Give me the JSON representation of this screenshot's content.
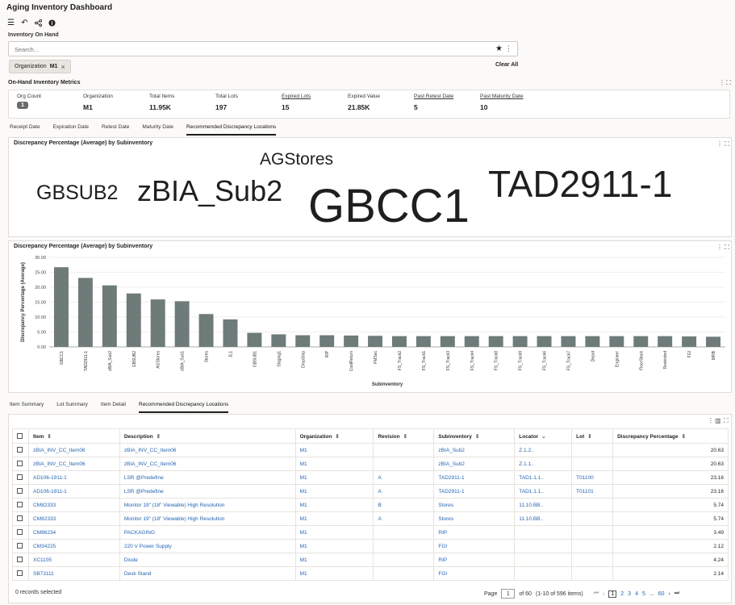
{
  "app": {
    "title": "Aging Inventory Dashboard"
  },
  "toolbar": {
    "icons": [
      "menu-icon",
      "undo-icon",
      "share-icon",
      "info-icon"
    ]
  },
  "section": {
    "inventory_on_hand": "Inventory On Hand"
  },
  "search": {
    "placeholder": "Search...",
    "value": ""
  },
  "filter_chip": {
    "label": "Organization",
    "value": "M1",
    "close": "×"
  },
  "clear_all": "Clear All",
  "metrics": {
    "title": "On-Hand Inventory Metrics",
    "items": [
      {
        "label": "Org Count",
        "value": "1"
      },
      {
        "label": "Organization",
        "value": "M1"
      },
      {
        "label": "Total Items",
        "value": "11.95K"
      },
      {
        "label": "Total Lots",
        "value": "197"
      },
      {
        "label": "Expired Lots",
        "value": "15"
      },
      {
        "label": "Expired Value",
        "value": "21.85K"
      },
      {
        "label": "Past Retest Date",
        "value": "5"
      },
      {
        "label": "Past Maturity Date",
        "value": "10"
      }
    ]
  },
  "tabs_top": [
    "Receipt Date",
    "Expiration Date",
    "Retest Date",
    "Maturity Date",
    "Recommended Discrepancy Locations"
  ],
  "tag_cloud": {
    "title": "Discrepancy Percentage (Average) by Subinventory",
    "words": [
      "GBSUB2",
      "zBIA_Sub2",
      "AGStores",
      "GBCC1",
      "TAD2911-1"
    ]
  },
  "chart_data": {
    "type": "bar",
    "title": "Discrepancy Percentage (Average) by Subinventory",
    "xlabel": "Subinventory",
    "ylabel": "Discrepancy Percentage (Average)",
    "ylim": [
      0,
      30
    ],
    "yticks": [
      "0.00",
      "5.00",
      "10.00",
      "15.00",
      "20.00",
      "25.00",
      "30.00"
    ],
    "categories": [
      "GBCC1",
      "TAD2911-1",
      "zBIA_Sub2",
      "GBSUB2",
      "AGStores",
      "zBIA_Sub1",
      "Stores",
      "JL1",
      "GBSUB1",
      "Staging1",
      "DropShip",
      "RIP",
      "CostReturn",
      "FMSec",
      "FS_Track2",
      "FS_Track1",
      "FS_Track3",
      "FS_Track4",
      "FS_Track8",
      "FS_Track9",
      "FS_Track6",
      "FS_Track7",
      "Depot",
      "Engineer",
      "FloorStock",
      "Restricted",
      "FGI",
      "MRB"
    ],
    "values": [
      26.7,
      23.1,
      20.6,
      17.9,
      15.9,
      15.3,
      11.0,
      9.2,
      4.7,
      4.2,
      3.9,
      3.9,
      3.8,
      3.7,
      3.6,
      3.6,
      3.6,
      3.6,
      3.6,
      3.6,
      3.6,
      3.6,
      3.6,
      3.6,
      3.6,
      3.6,
      3.5,
      3.4
    ],
    "bar_color": "#6e7b78",
    "grid": true
  },
  "tabs_bottom": [
    "Item Summary",
    "Lot Summary",
    "Item Detail",
    "Recommended Discrepancy Locations"
  ],
  "table": {
    "columns": [
      "Item",
      "Description",
      "Organization",
      "Revision",
      "Subinventory",
      "Locator",
      "Lot",
      "Discrepancy Percentage"
    ],
    "sort_icons": [
      "⇕",
      "⇕",
      "⇕",
      "⇕",
      "⇕",
      "⌄",
      "⇕",
      "⇕"
    ],
    "rows": [
      [
        "zBIA_INV_CC_Item06",
        "zBIA_INV_CC_Item06",
        "M1",
        "",
        "zBIA_Sub2",
        "Z.1.2..",
        "",
        "20.63"
      ],
      [
        "zBIA_INV_CC_Item06",
        "zBIA_INV_CC_Item06",
        "M1",
        "",
        "zBIA_Sub2",
        "Z.1.1..",
        "",
        "20.63"
      ],
      [
        "AD106-1911-1",
        "LSR @Predefine",
        "M1",
        "A",
        "TAD2911-1",
        "TAD1.1.1..",
        "T01100",
        "23.16"
      ],
      [
        "AD106-1911-1",
        "LSR @Predefine",
        "M1",
        "A",
        "TAD2911-1",
        "TAD1.1.1..",
        "T01101",
        "23.16"
      ],
      [
        "CM82333",
        "Monitor 19\" (18\" Viewable) High Resolution",
        "M1",
        "B",
        "Stores",
        "11.10.BB..",
        "",
        "5.74"
      ],
      [
        "CM82333",
        "Monitor 19\" (18\" Viewable) High Resolution",
        "M1",
        "A",
        "Stores",
        "11.10.BB..",
        "",
        "5.74"
      ],
      [
        "CM86234",
        "PACKAGING",
        "M1",
        "",
        "RIP",
        "",
        "",
        "3.49"
      ],
      [
        "CM34225",
        "220 V Power Supply",
        "M1",
        "",
        "FGI",
        "",
        "",
        "2.12"
      ],
      [
        "XC1105",
        "Diode",
        "M1",
        "",
        "RIP",
        "",
        "",
        "4.24"
      ],
      [
        "SB73111",
        "Desk Stand",
        "M1",
        "",
        "FGI",
        "",
        "",
        "2.14"
      ]
    ]
  },
  "footer": {
    "selected": "0 records selected",
    "page_label": "Page",
    "page_value": "1",
    "of_pages": "of 60",
    "range": "(1-10 of 596 items)",
    "pages": [
      "1",
      "2",
      "3",
      "4",
      "5",
      "...",
      "60"
    ]
  }
}
